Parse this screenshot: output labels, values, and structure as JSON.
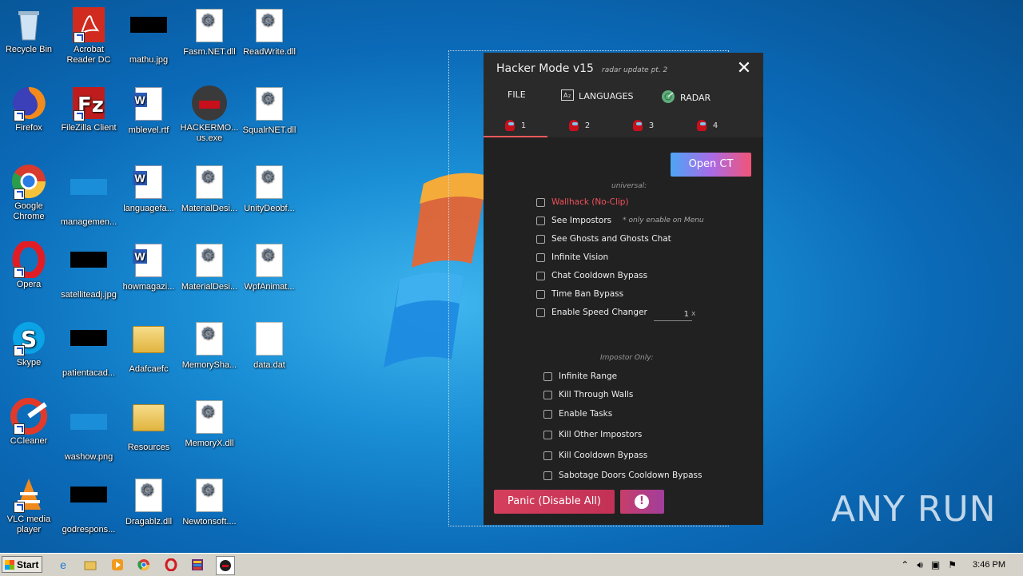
{
  "desktop_icons": [
    {
      "label": "Recycle Bin",
      "icon": "recycle-bin-icon"
    },
    {
      "label": "Acrobat Reader DC",
      "icon": "acrobat-icon"
    },
    {
      "label": "mathu.jpg",
      "icon": "image-file-icon"
    },
    {
      "label": "Fasm.NET.dll",
      "icon": "dll-file-icon"
    },
    {
      "label": "ReadWrite.dll",
      "icon": "dll-file-icon"
    },
    {
      "label": "Firefox",
      "icon": "firefox-icon"
    },
    {
      "label": "FileZilla Client",
      "icon": "filezilla-icon"
    },
    {
      "label": "mblevel.rtf",
      "icon": "word-doc-icon"
    },
    {
      "label": "HACKERMO... us.exe",
      "icon": "exe-icon"
    },
    {
      "label": "SqualrNET.dll",
      "icon": "dll-file-icon"
    },
    {
      "label": "Google Chrome",
      "icon": "chrome-icon"
    },
    {
      "label": "managemen...",
      "icon": "image-file-icon"
    },
    {
      "label": "languagefa...",
      "icon": "word-doc-icon"
    },
    {
      "label": "MaterialDesi...",
      "icon": "dll-file-icon"
    },
    {
      "label": "UnityDeobf...",
      "icon": "dll-file-icon"
    },
    {
      "label": "Opera",
      "icon": "opera-icon"
    },
    {
      "label": "satelliteadj.jpg",
      "icon": "image-file-icon"
    },
    {
      "label": "howmagazi...",
      "icon": "word-doc-icon"
    },
    {
      "label": "MaterialDesi...",
      "icon": "dll-file-icon"
    },
    {
      "label": "WpfAnimat...",
      "icon": "dll-file-icon"
    },
    {
      "label": "Skype",
      "icon": "skype-icon"
    },
    {
      "label": "patientacad...",
      "icon": "image-file-icon"
    },
    {
      "label": "Adafcaefc",
      "icon": "folder-icon"
    },
    {
      "label": "MemorySha...",
      "icon": "dll-file-icon"
    },
    {
      "label": "data.dat",
      "icon": "file-icon"
    },
    {
      "label": "CCleaner",
      "icon": "ccleaner-icon"
    },
    {
      "label": "washow.png",
      "icon": "image-file-icon"
    },
    {
      "label": "Resources",
      "icon": "folder-icon"
    },
    {
      "label": "MemoryX.dll",
      "icon": "dll-file-icon"
    },
    {
      "label": "VLC media player",
      "icon": "vlc-icon"
    },
    {
      "label": "godrespons...",
      "icon": "image-file-icon"
    },
    {
      "label": "Dragablz.dll",
      "icon": "dll-file-icon"
    },
    {
      "label": "Newtonsoft....",
      "icon": "dll-file-icon"
    }
  ],
  "app": {
    "title": "Hacker Mode v15",
    "subtitle": "radar update pt. 2",
    "menu": [
      {
        "label": "FILE"
      },
      {
        "label": "LANGUAGES"
      },
      {
        "label": "RADAR"
      }
    ],
    "player_tabs": [
      {
        "label": "1"
      },
      {
        "label": "2"
      },
      {
        "label": "3"
      },
      {
        "label": "4"
      }
    ],
    "open_ct": "Open CT",
    "universal_label": "universal:",
    "universal": [
      {
        "label": "Wallhack (No-Clip)",
        "note": ""
      },
      {
        "label": "See Impostors",
        "note": "* only enable on Menu"
      },
      {
        "label": "See Ghosts and Ghosts Chat",
        "note": ""
      },
      {
        "label": "Infinite Vision",
        "note": ""
      },
      {
        "label": "Chat Cooldown Bypass",
        "note": ""
      },
      {
        "label": "Time Ban Bypass",
        "note": ""
      },
      {
        "label": "Enable Speed Changer",
        "note": ""
      }
    ],
    "speed_value": "1",
    "speed_unit": "x",
    "impostor_label": "Impostor Only:",
    "impostor": [
      {
        "label": "Infinite Range"
      },
      {
        "label": "Kill Through Walls"
      },
      {
        "label": "Enable Tasks"
      },
      {
        "label": "Kill Other Impostors"
      },
      {
        "label": "Kill Cooldown Bypass"
      },
      {
        "label": "Sabotage Doors Cooldown Bypass"
      }
    ],
    "panic": "Panic (Disable All)",
    "alert_glyph": "!"
  },
  "watermark": "ANY RUN",
  "taskbar": {
    "start": "Start",
    "clock": "3:46 PM"
  }
}
